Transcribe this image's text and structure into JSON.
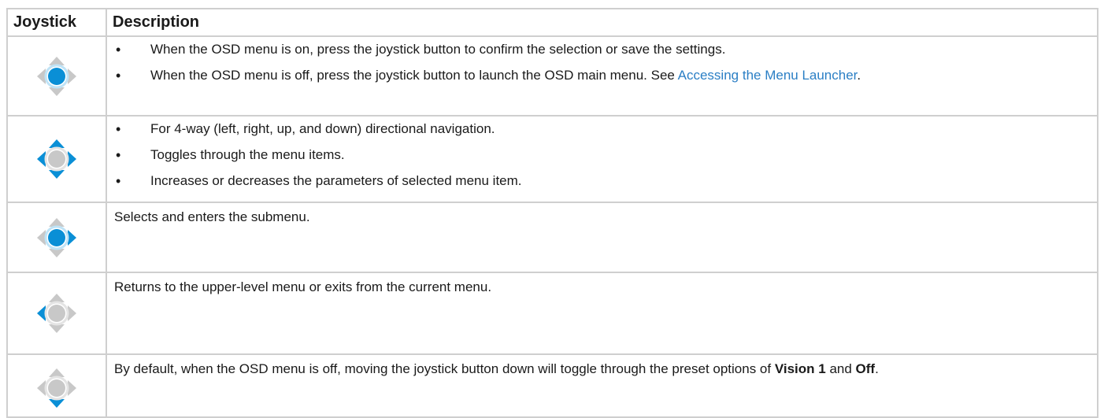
{
  "table": {
    "headers": {
      "joystick": "Joystick",
      "description": "Description"
    },
    "colors": {
      "active": "#0a8fd6",
      "inactive": "#c8c8c8",
      "link": "#2b7fc5",
      "border": "#cfcfcf"
    },
    "rows": [
      {
        "icon": "joystick-press-icon",
        "active": "center",
        "bullets": [
          {
            "text": "When the OSD menu is on, press the joystick button to confirm the selection or save the settings."
          },
          {
            "text": "When the OSD menu is off, press the joystick button to launch the OSD main menu. See ",
            "link": "Accessing the Menu Launcher",
            "after": "."
          }
        ]
      },
      {
        "icon": "joystick-4way-icon",
        "active": "four-way",
        "bullets": [
          {
            "text": "For 4-way (left, right, up, and down) directional navigation."
          },
          {
            "text": "Toggles through the menu items."
          },
          {
            "text": "Increases or decreases the parameters of selected menu item."
          }
        ]
      },
      {
        "icon": "joystick-right-icon",
        "active": "center-right",
        "text": "Selects and enters the submenu."
      },
      {
        "icon": "joystick-left-icon",
        "active": "left",
        "text": "Returns to the upper-level menu or exits from the current menu."
      },
      {
        "icon": "joystick-down-icon",
        "active": "down",
        "text_parts": [
          "By default, when the OSD menu is off, moving the joystick button down will toggle through the preset options of ",
          "Vision 1",
          " and ",
          "Off",
          "."
        ]
      }
    ]
  }
}
